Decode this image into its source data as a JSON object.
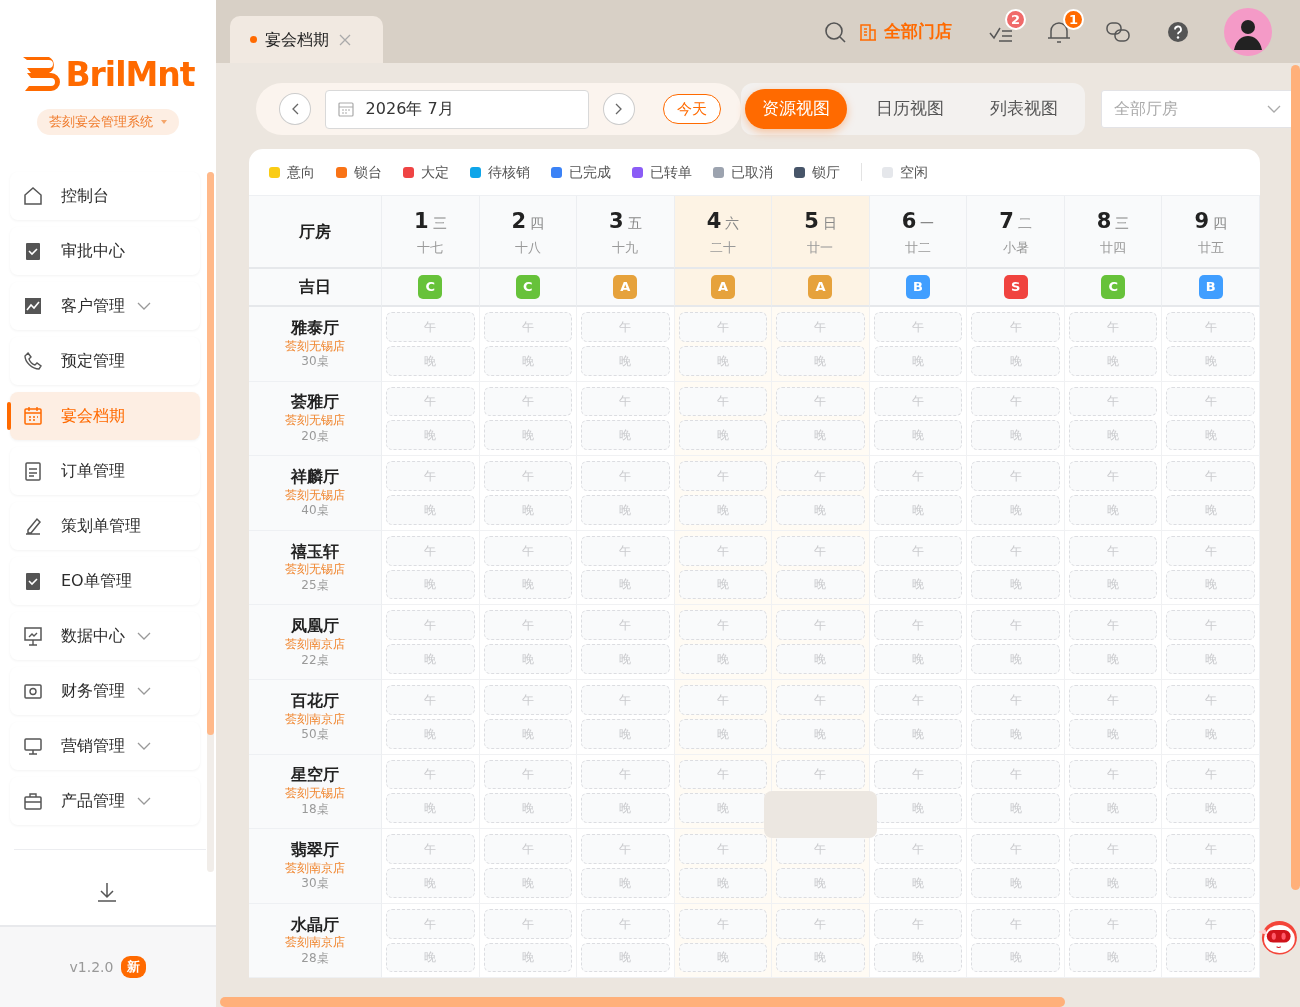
{
  "sidebar": {
    "logo": "BrilMnt",
    "system": "荟刻宴会管理系统",
    "items": [
      {
        "label": "控制台",
        "selected": false,
        "expandable": false
      },
      {
        "label": "审批中心",
        "selected": false,
        "expandable": false
      },
      {
        "label": "客户管理",
        "selected": false,
        "expandable": true
      },
      {
        "label": "预定管理",
        "selected": false,
        "expandable": false
      },
      {
        "label": "宴会档期",
        "selected": true,
        "expandable": false
      },
      {
        "label": "订单管理",
        "selected": false,
        "expandable": false
      },
      {
        "label": "策划单管理",
        "selected": false,
        "expandable": false
      },
      {
        "label": "EO单管理",
        "selected": false,
        "expandable": false
      },
      {
        "label": "数据中心",
        "selected": false,
        "expandable": true
      },
      {
        "label": "财务管理",
        "selected": false,
        "expandable": true
      },
      {
        "label": "营销管理",
        "selected": false,
        "expandable": true
      },
      {
        "label": "产品管理",
        "selected": false,
        "expandable": true
      }
    ],
    "version": "v1.2.0",
    "version_badge": "新"
  },
  "tabs": [
    {
      "label": "宴会档期",
      "selected": true
    }
  ],
  "topbar": {
    "store": "全部门店",
    "tasks_badge": "2",
    "notices_badge": "1"
  },
  "toolbar": {
    "date": "2026年 7月",
    "today": "今天",
    "views": [
      {
        "label": "资源视图",
        "selected": true
      },
      {
        "label": "日历视图",
        "selected": false
      },
      {
        "label": "列表视图",
        "selected": false
      }
    ],
    "hall_select": {
      "placeholder": "全部厅房"
    }
  },
  "legend": [
    {
      "label": "意向",
      "color": "#facc15",
      "kind": "status"
    },
    {
      "label": "锁台",
      "color": "#f97316",
      "kind": "status"
    },
    {
      "label": "大定",
      "color": "#ef4444",
      "kind": "status"
    },
    {
      "label": "待核销",
      "color": "#0ea5e9",
      "kind": "status"
    },
    {
      "label": "已完成",
      "color": "#3b82f6",
      "kind": "status"
    },
    {
      "label": "已转单",
      "color": "#8b5cf6",
      "kind": "status"
    },
    {
      "label": "已取消",
      "color": "#9ca3af",
      "kind": "status"
    },
    {
      "label": "锁厅",
      "color": "#475569",
      "kind": "status"
    },
    {
      "label": "空闲",
      "color": "#e5e7eb",
      "kind": "free"
    }
  ],
  "table": {
    "corner": "厅房",
    "lucky_label": "吉日",
    "days": [
      {
        "day": "1",
        "weekday": "三",
        "lunar": "十七",
        "weekend": false,
        "lucky": {
          "grade": "C",
          "color": "#67c23a"
        }
      },
      {
        "day": "2",
        "weekday": "四",
        "lunar": "十八",
        "weekend": false,
        "lucky": {
          "grade": "C",
          "color": "#67c23a"
        }
      },
      {
        "day": "3",
        "weekday": "五",
        "lunar": "十九",
        "weekend": false,
        "lucky": {
          "grade": "A",
          "color": "#e6a23c"
        }
      },
      {
        "day": "4",
        "weekday": "六",
        "lunar": "二十",
        "weekend": true,
        "lucky": {
          "grade": "A",
          "color": "#e6a23c"
        }
      },
      {
        "day": "5",
        "weekday": "日",
        "lunar": "廿一",
        "weekend": true,
        "lucky": {
          "grade": "A",
          "color": "#e6a23c"
        }
      },
      {
        "day": "6",
        "weekday": "一",
        "lunar": "廿二",
        "weekend": false,
        "lucky": {
          "grade": "B",
          "color": "#409eff"
        }
      },
      {
        "day": "7",
        "weekday": "二",
        "lunar": "小暑",
        "weekend": false,
        "lucky": {
          "grade": "S",
          "color": "#f0433f"
        }
      },
      {
        "day": "8",
        "weekday": "三",
        "lunar": "廿四",
        "weekend": false,
        "lucky": {
          "grade": "C",
          "color": "#67c23a"
        }
      },
      {
        "day": "9",
        "weekday": "四",
        "lunar": "廿五",
        "weekend": false,
        "lucky": {
          "grade": "B",
          "color": "#409eff"
        }
      }
    ],
    "rows": [
      {
        "name": "雅泰厅",
        "store": "荟刻无锡店",
        "tables": "30桌",
        "cells": [
          [
            "午",
            "晚"
          ],
          [
            "午",
            "晚"
          ],
          [
            "午",
            "晚"
          ],
          [
            "午",
            "晚"
          ],
          [
            "午",
            "晚"
          ],
          [
            "午",
            "晚"
          ],
          [
            "午",
            "晚"
          ],
          [
            "午",
            "晚"
          ],
          [
            "午",
            "晚"
          ]
        ]
      },
      {
        "name": "荟雅厅",
        "store": "荟刻无锡店",
        "tables": "20桌",
        "cells": [
          [
            "午",
            "晚"
          ],
          [
            "午",
            "晚"
          ],
          [
            "午",
            "晚"
          ],
          [
            "午",
            "晚"
          ],
          [
            "午",
            "晚"
          ],
          [
            "午",
            "晚"
          ],
          [
            "午",
            "晚"
          ],
          [
            "午",
            "晚"
          ],
          [
            "午",
            "晚"
          ]
        ]
      },
      {
        "name": "祥麟厅",
        "store": "荟刻无锡店",
        "tables": "40桌",
        "cells": [
          [
            "午",
            "晚"
          ],
          [
            "午",
            "晚"
          ],
          [
            "午",
            "晚"
          ],
          [
            "午",
            "晚"
          ],
          [
            "午",
            "晚"
          ],
          [
            "午",
            "晚"
          ],
          [
            "午",
            "晚"
          ],
          [
            "午",
            "晚"
          ],
          [
            "午",
            "晚"
          ]
        ]
      },
      {
        "name": "禧玉轩",
        "store": "荟刻无锡店",
        "tables": "25桌",
        "cells": [
          [
            "午",
            "晚"
          ],
          [
            "午",
            "晚"
          ],
          [
            "午",
            "晚"
          ],
          [
            "午",
            "晚"
          ],
          [
            "午",
            "晚"
          ],
          [
            "午",
            "晚"
          ],
          [
            "午",
            "晚"
          ],
          [
            "午",
            "晚"
          ],
          [
            "午",
            "晚"
          ]
        ]
      },
      {
        "name": "凤凰厅",
        "store": "荟刻南京店",
        "tables": "22桌",
        "cells": [
          [
            "午",
            "晚"
          ],
          [
            "午",
            "晚"
          ],
          [
            "午",
            "晚"
          ],
          [
            "午",
            "晚"
          ],
          [
            "午",
            "晚"
          ],
          [
            "午",
            "晚"
          ],
          [
            "午",
            "晚"
          ],
          [
            "午",
            "晚"
          ],
          [
            "午",
            "晚"
          ]
        ]
      },
      {
        "name": "百花厅",
        "store": "荟刻南京店",
        "tables": "50桌",
        "cells": [
          [
            "午",
            "晚"
          ],
          [
            "午",
            "晚"
          ],
          [
            "午",
            "晚"
          ],
          [
            "午",
            "晚"
          ],
          [
            "午",
            "晚"
          ],
          [
            "午",
            "晚"
          ],
          [
            "午",
            "晚"
          ],
          [
            "午",
            "晚"
          ],
          [
            "午",
            "晚"
          ]
        ]
      },
      {
        "name": "星空厅",
        "store": "荟刻无锡店",
        "tables": "18桌",
        "cells": [
          [
            "午",
            "晚"
          ],
          [
            "午",
            "晚"
          ],
          [
            "午",
            "晚"
          ],
          [
            "午",
            "晚"
          ],
          [
            "午"
          ],
          [
            "午",
            "晚"
          ],
          [
            "午",
            "晚"
          ],
          [
            "午",
            "晚"
          ],
          [
            "午",
            "晚"
          ]
        ]
      },
      {
        "name": "翡翠厅",
        "store": "荟刻南京店",
        "tables": "30桌",
        "cells": [
          [
            "午",
            "晚"
          ],
          [
            "午",
            "晚"
          ],
          [
            "午",
            "晚"
          ],
          [
            "午",
            "晚"
          ],
          [
            "午",
            "晚"
          ],
          [
            "午",
            "晚"
          ],
          [
            "午",
            "晚"
          ],
          [
            "午",
            "晚"
          ],
          [
            "午",
            "晚"
          ]
        ]
      },
      {
        "name": "水晶厅",
        "store": "荟刻南京店",
        "tables": "28桌",
        "cells": [
          [
            "午",
            "晚"
          ],
          [
            "午",
            "晚"
          ],
          [
            "午",
            "晚"
          ],
          [
            "午",
            "晚"
          ],
          [
            "午",
            "晚"
          ],
          [
            "午",
            "晚"
          ],
          [
            "午",
            "晚"
          ],
          [
            "午",
            "晚"
          ],
          [
            "午",
            "晚"
          ]
        ]
      }
    ]
  }
}
